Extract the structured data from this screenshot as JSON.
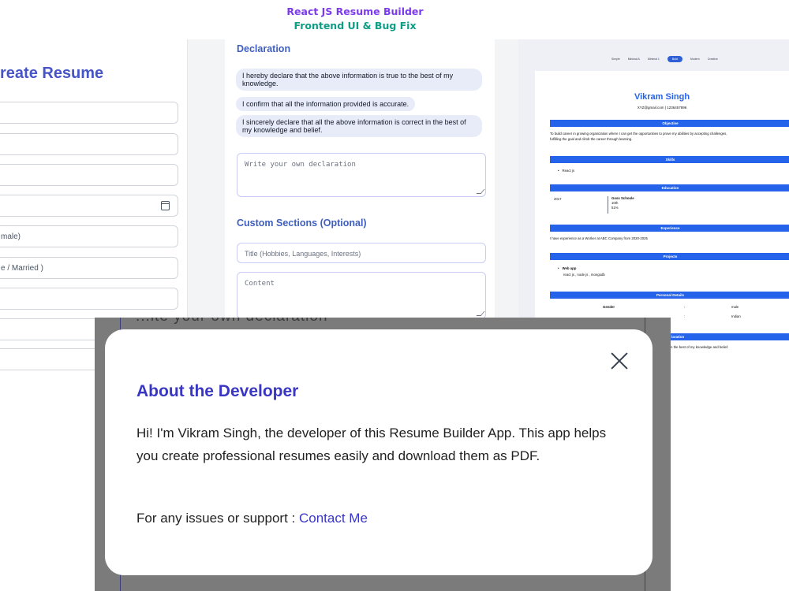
{
  "banner": {
    "line1": "React JS Resume Builder",
    "line2": "Frontend UI & Bug Fix"
  },
  "form": {
    "heading": "reate Resume",
    "fields": [
      "",
      "",
      "",
      "",
      "male)",
      "e / Married )",
      "",
      "",
      ""
    ]
  },
  "declaration": {
    "heading": "Declaration",
    "options": [
      "I hereby declare that the above information is true to the best of my knowledge.",
      "I confirm that all the information provided is accurate.",
      "I sincerely declare that all the above information is correct in the best of my knowledge and belief."
    ],
    "custom_placeholder": "Write your own declaration",
    "custom_sections_heading": "Custom Sections (Optional)",
    "title_placeholder": "Title (Hobbies, Languages, Interests)",
    "content_placeholder": "Content"
  },
  "preview": {
    "template_tabs": [
      "Simple",
      "Minimal A",
      "Minimal 1",
      "Bold",
      "Modern",
      "Creative"
    ],
    "active_tab_index": 3,
    "name": "Vikram Singh",
    "contact": "XYZ@gmail.com | 1236457896",
    "objective_heading": "Objective",
    "objective_text_1": "To build career in growing organization where I can get the opportunities to prove my abilities by accepting challenges,",
    "objective_text_2": "fulfilling the goal and climb the career through learning.",
    "skills_heading": "Skills",
    "skill_1": "React js",
    "education_heading": "Education",
    "edu_year": "2017",
    "edu_school": "Goss Schoole",
    "edu_class": "10th",
    "edu_percent": "51%",
    "experience_heading": "Experience",
    "experience_text": "I have experience as a Worker at ABC Company from 2020-2025",
    "projects_heading": "Projects",
    "project_name": "Web app",
    "project_tech": "react js , node js , mongodb",
    "personal_heading": "Personal Details",
    "gender_label": "Gender",
    "sep_1": ":",
    "gender_value": "male",
    "sep_2": ":",
    "nationality_value": "Indian",
    "declaration_heading_partial": "laration",
    "declaration_text_partial": "n the best of my knowledge and belief."
  },
  "overlay": {
    "ghost_text": "...ite your own declaration"
  },
  "modal": {
    "title": "About the Developer",
    "body": "Hi! I'm Vikram Singh, the developer of this Resume Builder App. This app helps you create professional resumes easily and download them as PDF.",
    "support_prefix": "For any issues or support :",
    "support_link": "Contact Me"
  },
  "colors": {
    "accent_blue": "#2563eb",
    "modal_title": "#3a36c4",
    "title_purple": "#7c3aed",
    "title_teal": "#0f9d86"
  }
}
